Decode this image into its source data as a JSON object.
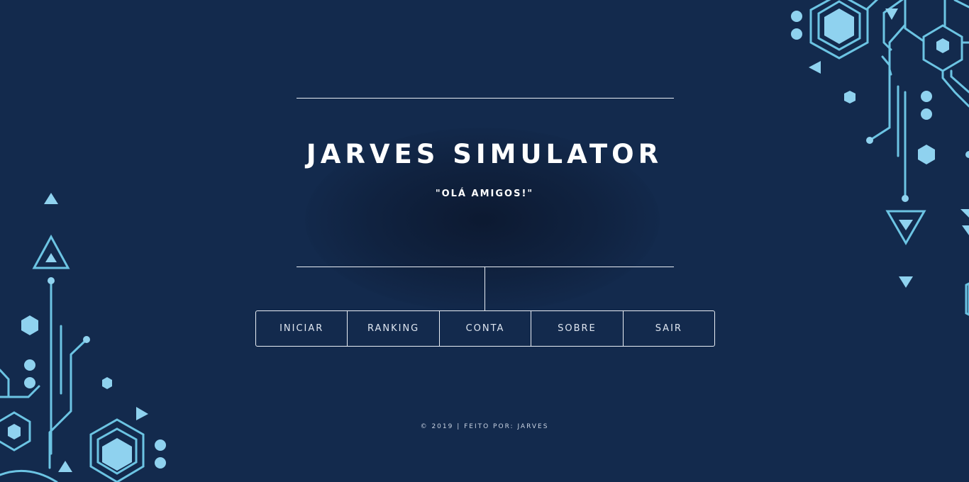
{
  "header": {
    "title": "JARVES SIMULATOR",
    "subtitle": "\"OLÁ AMIGOS!\""
  },
  "menu": {
    "items": [
      {
        "label": "INICIAR"
      },
      {
        "label": "RANKING"
      },
      {
        "label": "CONTA"
      },
      {
        "label": "SOBRE"
      },
      {
        "label": "SAIR"
      }
    ]
  },
  "footer": {
    "text": "© 2019 | FEITO POR: JARVES"
  },
  "colors": {
    "background": "#132a4d",
    "accent": "#8fd2ef",
    "accent_dark": "#56b6d6",
    "line": "#e9eef5"
  },
  "decorations": {
    "left": "circuit-pattern-left",
    "right": "circuit-pattern-right"
  }
}
